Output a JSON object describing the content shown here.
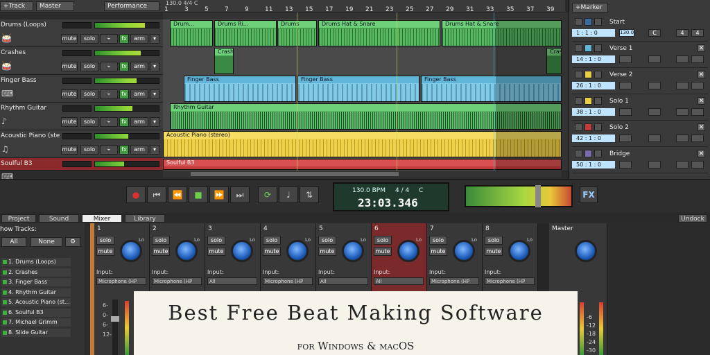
{
  "header": {
    "add_track": "+Track",
    "master": "Master",
    "performance": "Performance"
  },
  "ruler": {
    "tempo_label": "130.0 4/4 C",
    "ticks": [
      "1",
      "3",
      "5",
      "7",
      "9",
      "11",
      "13",
      "15",
      "17",
      "19",
      "21",
      "23",
      "25",
      "27",
      "29",
      "31",
      "33",
      "35",
      "37",
      "39"
    ]
  },
  "tracks": [
    {
      "name": "Drums (Loops)",
      "icon": "drum-icon"
    },
    {
      "name": "Crashes",
      "icon": "drum-icon"
    },
    {
      "name": "Finger Bass",
      "icon": "keyboard-icon"
    },
    {
      "name": "Rhythm Guitar",
      "icon": "guitar-icon"
    },
    {
      "name": "Acoustic Piano (ster...",
      "icon": "piano-icon"
    },
    {
      "name": "Soulful B3",
      "icon": "keyboard-icon"
    }
  ],
  "track_buttons": {
    "mute": "mute",
    "solo": "solo",
    "fx": "fx",
    "arm": "arm"
  },
  "clips": {
    "drums_1": "Drum...",
    "drums_2": "Drums Ri...",
    "drums_3": "Drums",
    "drums_4": "Drums Hat & Snare",
    "drums_5": "Drums Hat & Snare",
    "crash_1": "Crash",
    "crash_2": "Cras",
    "bass_1": "Finger Bass",
    "bass_2": "Finger Bass",
    "bass_3": "Finger Bass",
    "guitar": "Rhythm Guitar",
    "piano": "Acoustic Piano (stereo)",
    "b3": "Soulful B3"
  },
  "markers": {
    "add": "+Marker",
    "items": [
      {
        "name": "Start",
        "pos": "1 : 1 : 0",
        "tempo": "130.0",
        "key": "C",
        "sig1": "4",
        "sig2": "4"
      },
      {
        "name": "Verse 1",
        "pos": "14 : 1 : 0"
      },
      {
        "name": "Verse 2",
        "pos": "26 : 1 : 0"
      },
      {
        "name": "Solo 1",
        "pos": "38 : 1 : 0"
      },
      {
        "name": "Solo 2",
        "pos": "42 : 1 : 0"
      },
      {
        "name": "Bridge",
        "pos": "50 : 1 : 0"
      }
    ],
    "close": "✕"
  },
  "transport": {
    "bpm": "130.0 BPM",
    "sig": "4 / 4",
    "key": "C",
    "time": "23:03.346",
    "fx": "FX"
  },
  "tabs": {
    "project": "Project",
    "sound": "Sound",
    "mixer": "Mixer",
    "library": "Library",
    "undock": "Undock"
  },
  "show_tracks": {
    "title": "how Tracks:",
    "all": "All",
    "none": "None",
    "items": [
      "1. Drums (Loops)",
      "2. Crashes",
      "3. Finger Bass",
      "4. Rhythm Guitar",
      "5. Acoustic Piano (st...",
      "6. Soulful B3",
      "7. Michael Grimm",
      "8. Slide Guitar"
    ]
  },
  "mixer": {
    "solo": "solo",
    "mute": "mute",
    "input": "Input:",
    "lo": "Lo",
    "master": "Master",
    "channels": [
      {
        "n": "1",
        "in": "Microphone (HP"
      },
      {
        "n": "2",
        "in": "Microphone (HP"
      },
      {
        "n": "3",
        "in": "All"
      },
      {
        "n": "4",
        "in": "Microphone (HP"
      },
      {
        "n": "5",
        "in": "All"
      },
      {
        "n": "6",
        "in": "All"
      },
      {
        "n": "7",
        "in": "Microphone (HP"
      },
      {
        "n": "8",
        "in": "Microphone (HP"
      }
    ],
    "scale": [
      "6-",
      "0-",
      "6-",
      "12-"
    ],
    "meter_scale": [
      "-6",
      "-12",
      "-18",
      "-24",
      "-30"
    ]
  },
  "overlay": {
    "title": "Best Free Beat Making Software",
    "subtitle": "for Windows & macOS"
  },
  "colors": {
    "drums": "#5cc16a",
    "bass": "#5fb6d8",
    "guitar": "#5cc16a",
    "piano": "#f0d24a",
    "b3": "#c23a3a",
    "accent": "#c27a38"
  }
}
